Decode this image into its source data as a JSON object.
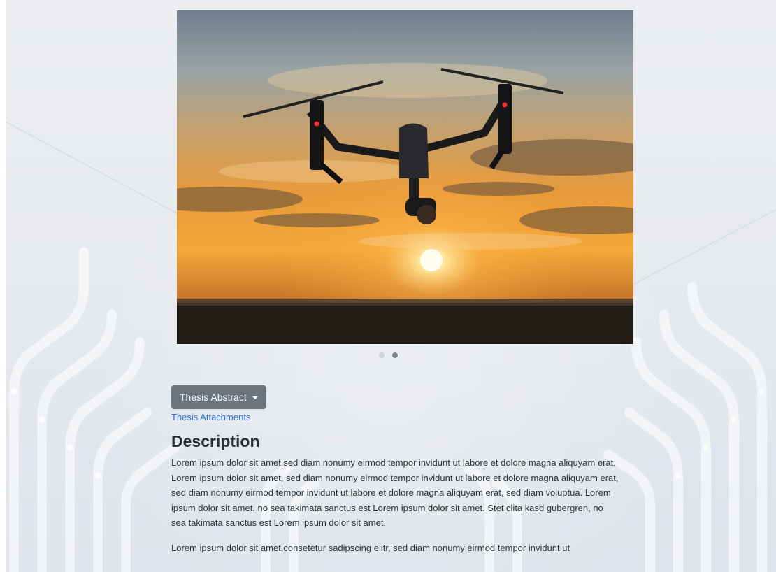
{
  "carousel": {
    "image_alt": "Drone flying at sunset",
    "slides": 2,
    "active_index": 1
  },
  "abstract_button": {
    "label": "Thesis Abstract"
  },
  "attachments_link": {
    "label": "Thesis Attachments"
  },
  "description": {
    "heading": "Description",
    "paragraph1": "Lorem ipsum dolor sit amet,sed diam nonumy eirmod tempor invidunt ut labore et dolore magna aliquyam erat, Lorem ipsum dolor sit amet, sed diam nonumy eirmod tempor invidunt ut labore et dolore magna aliquyam erat, sed diam nonumy eirmod tempor invidunt ut labore et dolore magna aliquyam erat, sed diam voluptua. Lorem ipsum dolor sit amet, no sea takimata sanctus est Lorem ipsum dolor sit amet. Stet clita kasd gubergren, no sea takimata sanctus est Lorem ipsum dolor sit amet.",
    "paragraph2": "Lorem ipsum dolor sit amet,consetetur sadipscing elitr, sed diam nonumy eirmod tempor invidunt ut"
  },
  "colors": {
    "button_bg": "#6c757d",
    "link": "#2f6fd6",
    "indicator_active": "#7c8590",
    "indicator_inactive": "#cfd4da"
  }
}
